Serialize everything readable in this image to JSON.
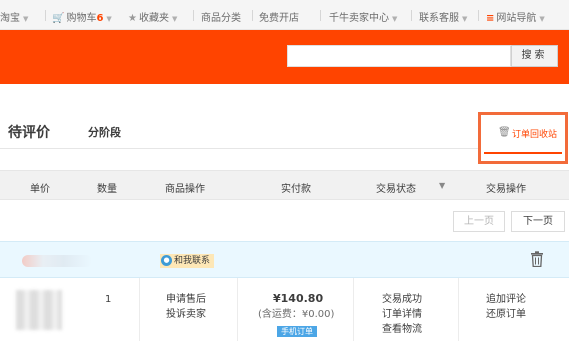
{
  "topnav": {
    "items": [
      {
        "label": "淘宝"
      },
      {
        "label": "购物车"
      },
      {
        "cart_count": "6"
      },
      {
        "label": "收藏夹"
      },
      {
        "label": "商品分类"
      },
      {
        "label": "免费开店"
      },
      {
        "label": "千牛卖家中心"
      },
      {
        "label": "联系客服"
      },
      {
        "label": "网站导航"
      }
    ]
  },
  "search": {
    "button_label": "搜索",
    "placeholder": ""
  },
  "tabs": {
    "current": "待评价",
    "sub": "分阶段"
  },
  "recycle_bin": {
    "label": "订单回收站"
  },
  "table": {
    "headers": [
      "单价",
      "数量",
      "商品操作",
      "实付款",
      "交易状态",
      "交易操作"
    ]
  },
  "pager": {
    "prev": "上一页",
    "next": "下一页"
  },
  "order": {
    "contact_label": "和我联系",
    "quantity": "1",
    "item_actions": [
      "申请售后",
      "投诉卖家"
    ],
    "total": "¥140.80",
    "shipping": "(含运费：¥0.00)",
    "source_tag": "手机订单",
    "status_links": [
      "交易成功",
      "订单详情",
      "查看物流"
    ],
    "trade_actions": [
      "追加评论",
      "还原订单"
    ]
  },
  "colors": {
    "accent": "#ff4400",
    "highlight_border": "#f26b3a"
  }
}
